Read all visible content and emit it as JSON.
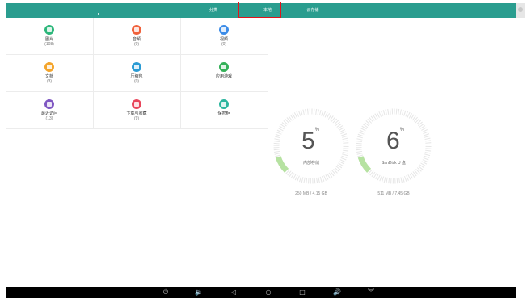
{
  "tabs": [
    "分类",
    "本地",
    "云存储"
  ],
  "categories": [
    {
      "name": "图片",
      "count": "(108)",
      "icon": "image-icon",
      "color": "#2db77b"
    },
    {
      "name": "音频",
      "count": "(0)",
      "icon": "music-icon",
      "color": "#f0623c"
    },
    {
      "name": "视频",
      "count": "(0)",
      "icon": "video-icon",
      "color": "#3c8ce8"
    },
    {
      "name": "文档",
      "count": "(3)",
      "icon": "document-icon",
      "color": "#f4a52c"
    },
    {
      "name": "压缩包",
      "count": "(0)",
      "icon": "archive-icon",
      "color": "#2a9bd4"
    },
    {
      "name": "应用游戏",
      "count": "",
      "icon": "apps-icon",
      "color": "#34b058"
    },
    {
      "name": "最近访问",
      "count": "(13)",
      "icon": "recent-icon",
      "color": "#7f57c2"
    },
    {
      "name": "下载与收藏",
      "count": "(9)",
      "icon": "star-icon",
      "color": "#e8455a"
    },
    {
      "name": "保密柜",
      "count": "",
      "icon": "safe-icon",
      "color": "#2bb59e"
    }
  ],
  "storage": [
    {
      "percent": "5",
      "label": "内部存储",
      "size": "250 MB / 4.15 GB",
      "fraction": 0.05
    },
    {
      "percent": "6",
      "label": "SanDisk U 盘",
      "size": "511 MB / 7.45 GB",
      "fraction": 0.06
    }
  ],
  "percent_sign": "%",
  "colors": {
    "accent": "#2a9d8f",
    "gauge_track": "#e6e6e6",
    "gauge_fill": "#b6e2a1"
  },
  "navbar_icons": [
    "power-icon",
    "volume-down-icon",
    "back-icon",
    "home-icon",
    "recents-icon",
    "volume-up-icon",
    "collapse-icon"
  ]
}
